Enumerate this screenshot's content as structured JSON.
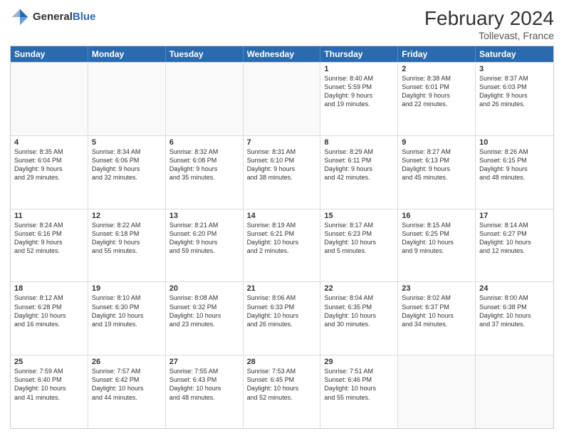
{
  "logo": {
    "general": "General",
    "blue": "Blue"
  },
  "title": "February 2024",
  "location": "Tollevast, France",
  "header_days": [
    "Sunday",
    "Monday",
    "Tuesday",
    "Wednesday",
    "Thursday",
    "Friday",
    "Saturday"
  ],
  "weeks": [
    [
      {
        "day": "",
        "info": ""
      },
      {
        "day": "",
        "info": ""
      },
      {
        "day": "",
        "info": ""
      },
      {
        "day": "",
        "info": ""
      },
      {
        "day": "1",
        "info": "Sunrise: 8:40 AM\nSunset: 5:59 PM\nDaylight: 9 hours\nand 19 minutes."
      },
      {
        "day": "2",
        "info": "Sunrise: 8:38 AM\nSunset: 6:01 PM\nDaylight: 9 hours\nand 22 minutes."
      },
      {
        "day": "3",
        "info": "Sunrise: 8:37 AM\nSunset: 6:03 PM\nDaylight: 9 hours\nand 26 minutes."
      }
    ],
    [
      {
        "day": "4",
        "info": "Sunrise: 8:35 AM\nSunset: 6:04 PM\nDaylight: 9 hours\nand 29 minutes."
      },
      {
        "day": "5",
        "info": "Sunrise: 8:34 AM\nSunset: 6:06 PM\nDaylight: 9 hours\nand 32 minutes."
      },
      {
        "day": "6",
        "info": "Sunrise: 8:32 AM\nSunset: 6:08 PM\nDaylight: 9 hours\nand 35 minutes."
      },
      {
        "day": "7",
        "info": "Sunrise: 8:31 AM\nSunset: 6:10 PM\nDaylight: 9 hours\nand 38 minutes."
      },
      {
        "day": "8",
        "info": "Sunrise: 8:29 AM\nSunset: 6:11 PM\nDaylight: 9 hours\nand 42 minutes."
      },
      {
        "day": "9",
        "info": "Sunrise: 8:27 AM\nSunset: 6:13 PM\nDaylight: 9 hours\nand 45 minutes."
      },
      {
        "day": "10",
        "info": "Sunrise: 8:26 AM\nSunset: 6:15 PM\nDaylight: 9 hours\nand 48 minutes."
      }
    ],
    [
      {
        "day": "11",
        "info": "Sunrise: 8:24 AM\nSunset: 6:16 PM\nDaylight: 9 hours\nand 52 minutes."
      },
      {
        "day": "12",
        "info": "Sunrise: 8:22 AM\nSunset: 6:18 PM\nDaylight: 9 hours\nand 55 minutes."
      },
      {
        "day": "13",
        "info": "Sunrise: 8:21 AM\nSunset: 6:20 PM\nDaylight: 9 hours\nand 59 minutes."
      },
      {
        "day": "14",
        "info": "Sunrise: 8:19 AM\nSunset: 6:21 PM\nDaylight: 10 hours\nand 2 minutes."
      },
      {
        "day": "15",
        "info": "Sunrise: 8:17 AM\nSunset: 6:23 PM\nDaylight: 10 hours\nand 5 minutes."
      },
      {
        "day": "16",
        "info": "Sunrise: 8:15 AM\nSunset: 6:25 PM\nDaylight: 10 hours\nand 9 minutes."
      },
      {
        "day": "17",
        "info": "Sunrise: 8:14 AM\nSunset: 6:27 PM\nDaylight: 10 hours\nand 12 minutes."
      }
    ],
    [
      {
        "day": "18",
        "info": "Sunrise: 8:12 AM\nSunset: 6:28 PM\nDaylight: 10 hours\nand 16 minutes."
      },
      {
        "day": "19",
        "info": "Sunrise: 8:10 AM\nSunset: 6:30 PM\nDaylight: 10 hours\nand 19 minutes."
      },
      {
        "day": "20",
        "info": "Sunrise: 8:08 AM\nSunset: 6:32 PM\nDaylight: 10 hours\nand 23 minutes."
      },
      {
        "day": "21",
        "info": "Sunrise: 8:06 AM\nSunset: 6:33 PM\nDaylight: 10 hours\nand 26 minutes."
      },
      {
        "day": "22",
        "info": "Sunrise: 8:04 AM\nSunset: 6:35 PM\nDaylight: 10 hours\nand 30 minutes."
      },
      {
        "day": "23",
        "info": "Sunrise: 8:02 AM\nSunset: 6:37 PM\nDaylight: 10 hours\nand 34 minutes."
      },
      {
        "day": "24",
        "info": "Sunrise: 8:00 AM\nSunset: 6:38 PM\nDaylight: 10 hours\nand 37 minutes."
      }
    ],
    [
      {
        "day": "25",
        "info": "Sunrise: 7:59 AM\nSunset: 6:40 PM\nDaylight: 10 hours\nand 41 minutes."
      },
      {
        "day": "26",
        "info": "Sunrise: 7:57 AM\nSunset: 6:42 PM\nDaylight: 10 hours\nand 44 minutes."
      },
      {
        "day": "27",
        "info": "Sunrise: 7:55 AM\nSunset: 6:43 PM\nDaylight: 10 hours\nand 48 minutes."
      },
      {
        "day": "28",
        "info": "Sunrise: 7:53 AM\nSunset: 6:45 PM\nDaylight: 10 hours\nand 52 minutes."
      },
      {
        "day": "29",
        "info": "Sunrise: 7:51 AM\nSunset: 6:46 PM\nDaylight: 10 hours\nand 55 minutes."
      },
      {
        "day": "",
        "info": ""
      },
      {
        "day": "",
        "info": ""
      }
    ]
  ]
}
